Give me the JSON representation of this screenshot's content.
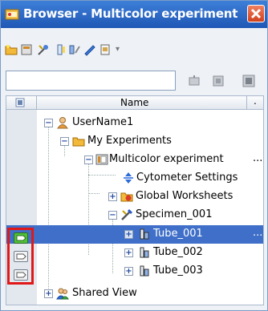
{
  "window": {
    "title": "Browser - Multicolor experiment"
  },
  "toolbar": {
    "icons": [
      "new-folder-icon",
      "new-experiment-icon",
      "tools-icon",
      "specimen-icon",
      "tube-icon",
      "brush-icon",
      "worksheet-icon"
    ]
  },
  "search": {
    "value": "",
    "placeholder": ""
  },
  "header": {
    "name": "Name",
    "extra": "."
  },
  "tree": {
    "user": "UserName1",
    "my_experiments": "My Experiments",
    "experiment": "Multicolor experiment",
    "cytometer": "Cytometer Settings",
    "global_ws": "Global Worksheets",
    "specimen": "Specimen_001",
    "tube1": "Tube_001",
    "tube2": "Tube_002",
    "tube3": "Tube_003",
    "shared": "Shared View",
    "ellipsis": "..."
  },
  "colors": {
    "selection": "#3f6fc8",
    "title_bar": "#1f57b5",
    "highlight_box": "#e01818",
    "active_indicator": "#4fbf3a"
  }
}
